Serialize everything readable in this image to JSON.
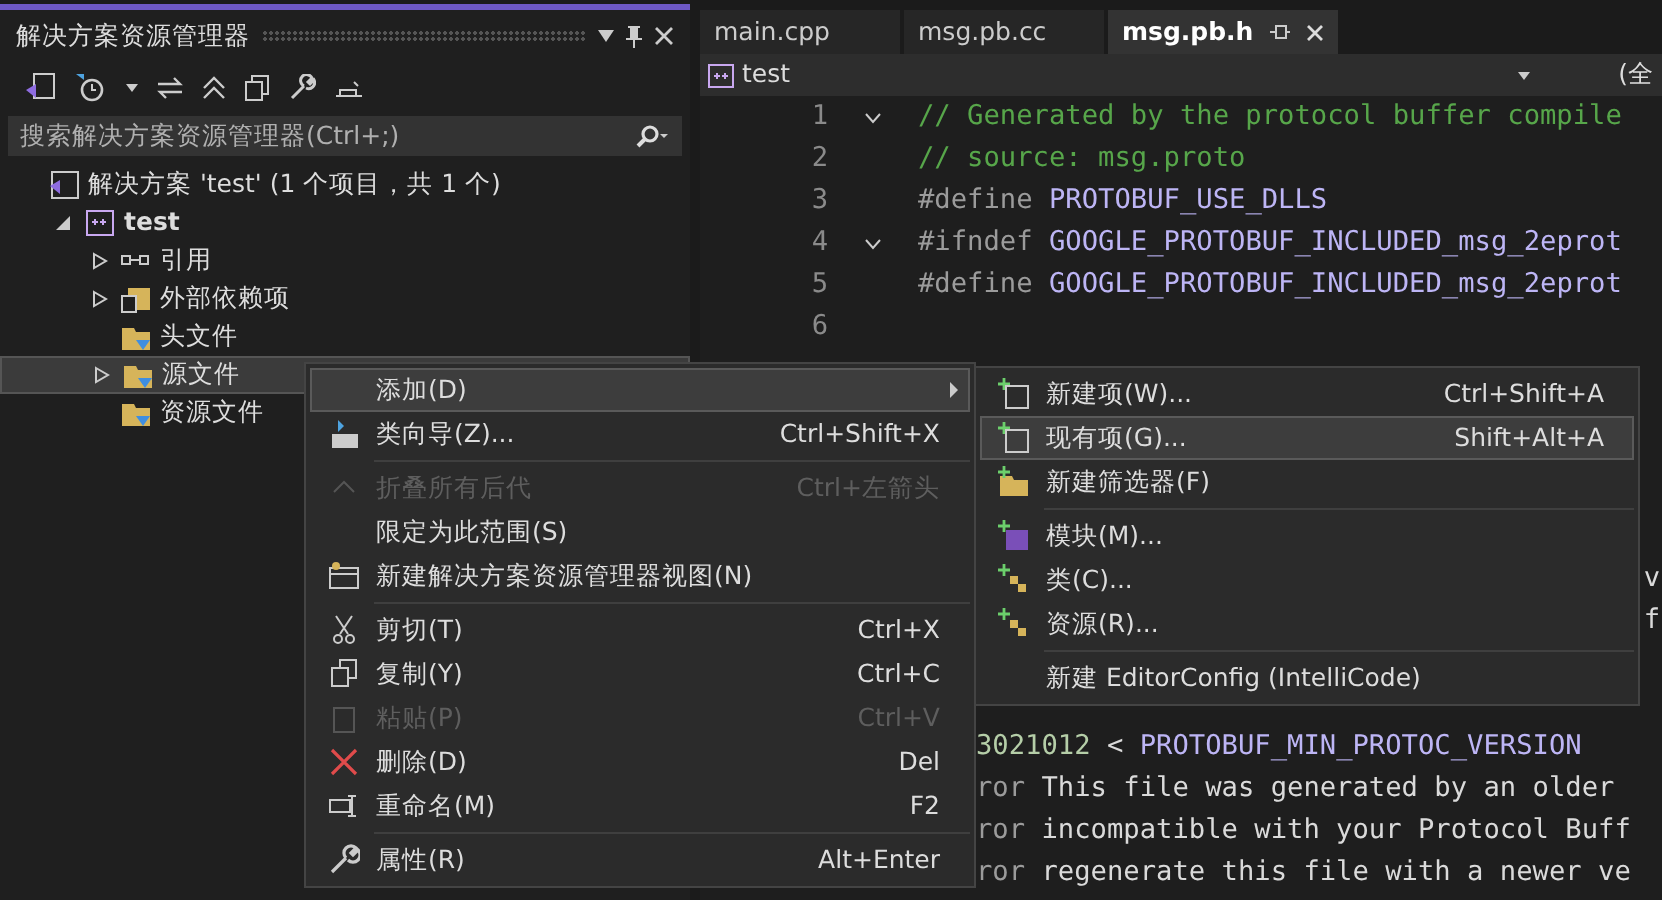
{
  "explorer": {
    "title": "解决方案资源管理器",
    "search": {
      "placeholder": "搜索解决方案资源管理器(Ctrl+;)"
    },
    "tree": [
      {
        "label": "解决方案 'test' (1 个项目，共 1 个)",
        "kind": "solution",
        "children": [
          {
            "label": "test",
            "kind": "project",
            "expanded": true,
            "children": [
              {
                "label": "引用",
                "kind": "refs",
                "expanded": false,
                "selected": false
              },
              {
                "label": "外部依赖项",
                "kind": "deps",
                "expanded": false,
                "selected": false
              },
              {
                "label": "头文件",
                "kind": "filter",
                "selected": false
              },
              {
                "label": "源文件",
                "kind": "filter",
                "expanded": false,
                "selected": true
              },
              {
                "label": "资源文件",
                "kind": "filter",
                "selected": false
              }
            ]
          }
        ]
      }
    ]
  },
  "editor": {
    "tabs": [
      {
        "label": "main.cpp",
        "selected": false
      },
      {
        "label": "msg.pb.cc",
        "selected": false
      },
      {
        "label": "msg.pb.h",
        "selected": true
      }
    ],
    "project": "test",
    "scope": "(全",
    "lines": [
      {
        "number": "1",
        "kind": "full",
        "fold": true,
        "tokens": [
          {
            "t": "// Generated by the protocol buffer compile",
            "kind": "comment"
          }
        ]
      },
      {
        "number": "2",
        "kind": "full",
        "fold": false,
        "tokens": [
          {
            "t": "// source: msg.proto",
            "kind": "comment"
          }
        ]
      },
      {
        "number": "3",
        "kind": "full",
        "fold": false,
        "tokens": [
          {
            "t": "#define ",
            "kind": "pre"
          },
          {
            "t": "PROTOBUF_USE_DLLS",
            "kind": "macro"
          }
        ]
      },
      {
        "number": "4",
        "kind": "full",
        "fold": true,
        "tokens": [
          {
            "t": "#ifndef ",
            "kind": "pre"
          },
          {
            "t": "GOOGLE_PROTOBUF_INCLUDED_msg_2eprot",
            "kind": "macro"
          }
        ]
      },
      {
        "number": "5",
        "kind": "full",
        "fold": false,
        "tokens": [
          {
            "t": "#define ",
            "kind": "pre"
          },
          {
            "t": "GOOGLE_PROTOBUF_INCLUDED_msg_2eprot",
            "kind": "macro"
          }
        ]
      },
      {
        "number": "6",
        "kind": "full",
        "fold": false
      },
      {
        "kind": "hidden"
      },
      {
        "kind": "hidden"
      },
      {
        "kind": "hidden"
      },
      {
        "kind": "hidden"
      },
      {
        "kind": "hidden"
      },
      {
        "kind": "edge",
        "tokens": [
          {
            "t": "v",
            "kind": "plain"
          }
        ]
      },
      {
        "kind": "edge",
        "tokens": [
          {
            "t": "f",
            "kind": "plain"
          }
        ]
      },
      {
        "kind": "hidden"
      },
      {
        "kind": "hidden"
      },
      {
        "kind": "tail",
        "tokens": [
          {
            "t": "3021012",
            "kind": "number"
          },
          {
            "t": " < ",
            "kind": "plain"
          },
          {
            "t": "PROTOBUF_MIN_PROTOC_VERSION",
            "kind": "macro"
          }
        ]
      },
      {
        "kind": "tail",
        "tokens": [
          {
            "t": "ror",
            "kind": "pre"
          },
          {
            "t": " This file was generated by an older",
            "kind": "plain"
          }
        ]
      },
      {
        "kind": "tail",
        "tokens": [
          {
            "t": "ror",
            "kind": "pre"
          },
          {
            "t": " incompatible with your Protocol Buff",
            "kind": "plain"
          }
        ]
      },
      {
        "kind": "tail",
        "tokens": [
          {
            "t": "ror",
            "kind": "pre"
          },
          {
            "t": " regenerate this file with a newer ve",
            "kind": "plain"
          }
        ]
      }
    ]
  },
  "context_menu": {
    "items": [
      {
        "kind": "item",
        "label": "添加(D)",
        "submenu": true,
        "selected": true,
        "disabled": false
      },
      {
        "kind": "item",
        "label": "类向导(Z)...",
        "shortcut": "Ctrl+Shift+X",
        "selected": false,
        "disabled": false
      },
      {
        "kind": "separator"
      },
      {
        "kind": "item",
        "label": "折叠所有后代",
        "shortcut": "Ctrl+左箭头",
        "selected": false,
        "disabled": true
      },
      {
        "kind": "item",
        "label": "限定为此范围(S)",
        "selected": false,
        "disabled": false
      },
      {
        "kind": "item",
        "label": "新建解决方案资源管理器视图(N)",
        "selected": false,
        "disabled": false
      },
      {
        "kind": "separator"
      },
      {
        "kind": "item",
        "label": "剪切(T)",
        "shortcut": "Ctrl+X",
        "selected": false,
        "disabled": false
      },
      {
        "kind": "item",
        "label": "复制(Y)",
        "shortcut": "Ctrl+C",
        "selected": false,
        "disabled": false
      },
      {
        "kind": "item",
        "label": "粘贴(P)",
        "shortcut": "Ctrl+V",
        "selected": false,
        "disabled": true
      },
      {
        "kind": "item",
        "label": "删除(D)",
        "shortcut": "Del",
        "selected": false,
        "disabled": false
      },
      {
        "kind": "item",
        "label": "重命名(M)",
        "shortcut": "F2",
        "selected": false,
        "disabled": false
      },
      {
        "kind": "separator"
      },
      {
        "kind": "item",
        "label": "属性(R)",
        "shortcut": "Alt+Enter",
        "selected": false,
        "disabled": false
      }
    ]
  },
  "submenu": {
    "items": [
      {
        "kind": "item",
        "label": "新建项(W)...",
        "shortcut": "Ctrl+Shift+A",
        "selected": false
      },
      {
        "kind": "item",
        "label": "现有项(G)...",
        "shortcut": "Shift+Alt+A",
        "selected": true
      },
      {
        "kind": "item",
        "label": "新建筛选器(F)",
        "selected": false
      },
      {
        "kind": "separator"
      },
      {
        "kind": "item",
        "label": "模块(M)...",
        "selected": false
      },
      {
        "kind": "item",
        "label": "类(C)...",
        "selected": false
      },
      {
        "kind": "item",
        "label": "资源(R)...",
        "selected": false
      },
      {
        "kind": "separator"
      },
      {
        "kind": "item",
        "label": "新建 EditorConfig (IntelliCode)",
        "selected": false
      }
    ]
  }
}
